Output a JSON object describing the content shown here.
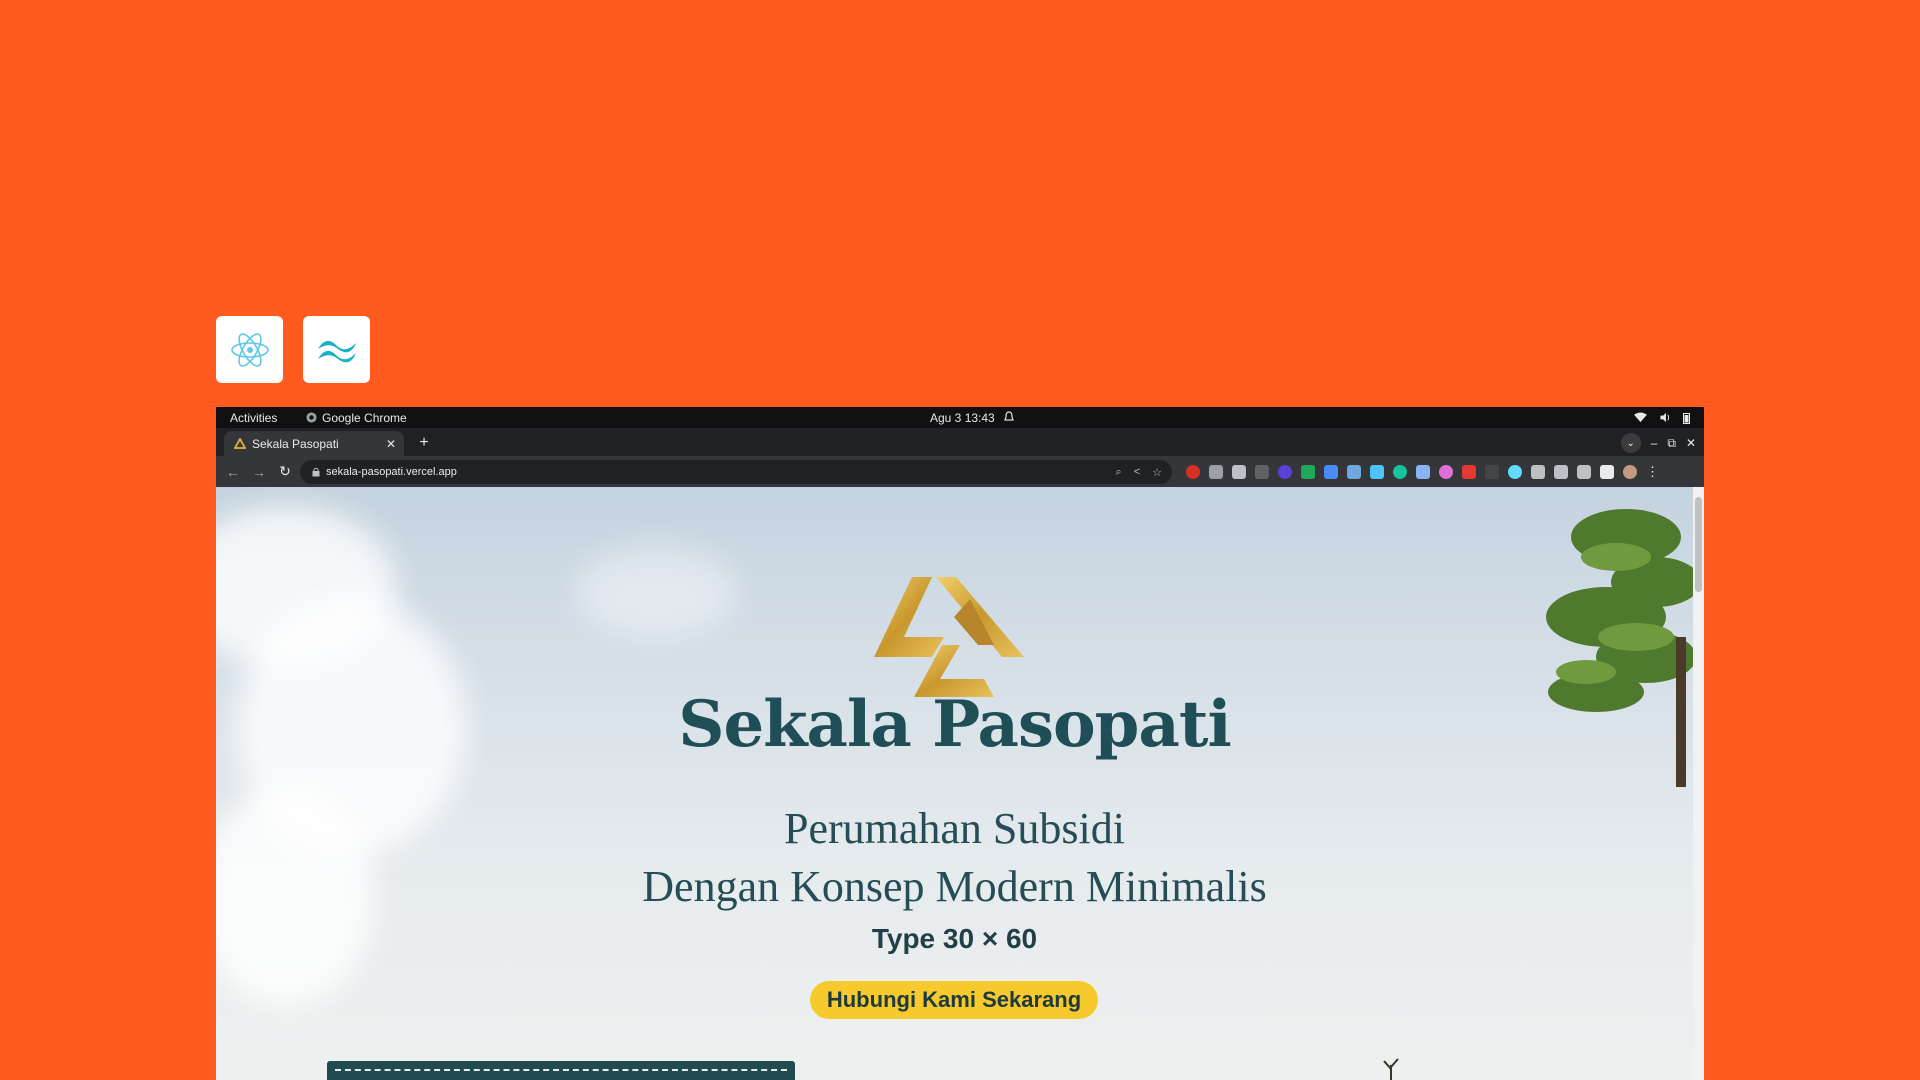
{
  "badges": [
    {
      "name": "react-logo-icon"
    },
    {
      "name": "tailwind-logo-icon"
    }
  ],
  "os_bar": {
    "activities": "Activities",
    "app_name": "Google Chrome",
    "clock": "Agu 3  13:43"
  },
  "browser": {
    "tab_title": "Sekala Pasopati",
    "url": "sekala-pasopati.vercel.app"
  },
  "hero": {
    "brand_name": "Sekala Pasopati",
    "subtitle_line1": "Perumahan Subsidi",
    "subtitle_line2": "Dengan Konsep Modern Minimalis",
    "type_label": "Type 30 × 60",
    "cta_label": "Hubungi Kami Sekarang"
  },
  "colors": {
    "background_orange": "#FF5B21",
    "brand_teal": "#1f4e56",
    "logo_gold": "#d4a83a",
    "cta_yellow": "#f6c92c"
  }
}
